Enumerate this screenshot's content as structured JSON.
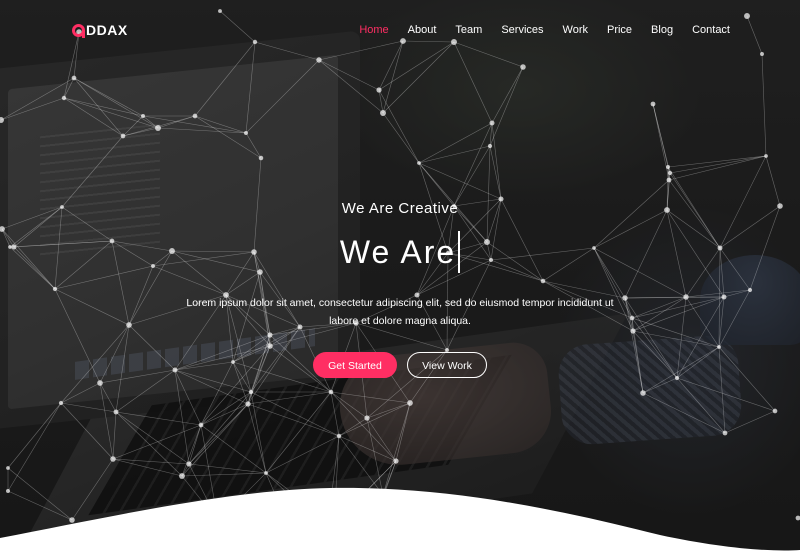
{
  "brand": {
    "logo_text": "DDAX",
    "accent_color": "#ff2e63"
  },
  "nav": {
    "items": [
      {
        "label": "Home",
        "active": true
      },
      {
        "label": "About",
        "active": false
      },
      {
        "label": "Team",
        "active": false
      },
      {
        "label": "Services",
        "active": false
      },
      {
        "label": "Work",
        "active": false
      },
      {
        "label": "Price",
        "active": false
      },
      {
        "label": "Blog",
        "active": false
      },
      {
        "label": "Contact",
        "active": false
      }
    ]
  },
  "hero": {
    "subtitle": "We Are Creative",
    "typed_headline": "We Are",
    "description": "Lorem ipsum dolor sit amet, consectetur adipiscing elit, sed do eiusmod tempor incididunt ut labore et dolore magna aliqua.",
    "primary_button": "Get Started",
    "secondary_button": "View Work"
  }
}
